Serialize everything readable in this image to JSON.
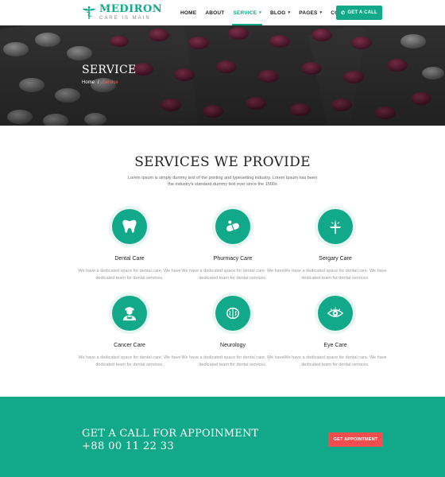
{
  "brand": {
    "name": "MEDIRON",
    "tagline": "CARE IS MAIN",
    "color": "#11a98a"
  },
  "nav": {
    "items": [
      {
        "label": "HOME",
        "dropdown": false,
        "active": false
      },
      {
        "label": "ABOUT",
        "dropdown": false,
        "active": false
      },
      {
        "label": "SERVICE",
        "dropdown": true,
        "active": true
      },
      {
        "label": "BLOG",
        "dropdown": true,
        "active": false
      },
      {
        "label": "PAGES",
        "dropdown": true,
        "active": false
      },
      {
        "label": "CONTACT",
        "dropdown": false,
        "active": false
      }
    ],
    "call_button": "GET A CALL"
  },
  "hero": {
    "title": "SERVICE",
    "breadcrumb": {
      "home": "Home",
      "separator": "/",
      "current": "Service"
    }
  },
  "services": {
    "title": "SERVICES WE PROVIDE",
    "description": "Lorem Ipsum is simply dummy text of the printing and typesetting industry. Lorem Ipsum has been the industry's standard dummy text ever since the 1500s",
    "items": [
      {
        "title": "Dental Care",
        "icon": "tooth-icon",
        "text": "We have a dedicated space for dental care. We have dedicated team for dental services."
      },
      {
        "title": "Phurmacy Care",
        "icon": "pills-icon",
        "text": "We have a dedicated space for dental care. We have dedicated team for dental services."
      },
      {
        "title": "Sergary Care",
        "icon": "scalpel-icon",
        "text": "We have a dedicated space for dental care. We have dedicated team for dental services."
      },
      {
        "title": "Cancer Care",
        "icon": "doctor-icon",
        "text": "We have a dedicated space for dental care. We have dedicated team for dental services."
      },
      {
        "title": "Neurology",
        "icon": "brain-icon",
        "text": "We have a dedicated space for dental care. We have dedicated team for dental services."
      },
      {
        "title": "Eye Care",
        "icon": "eye-icon",
        "text": "We have a dedicated space for dental care. We have dedicated team for dental services."
      }
    ]
  },
  "cta": {
    "title": "GET A CALL FOR APPOINMENT",
    "phone": "+88 00 11 22 33",
    "button": "GET APPOINTMENT",
    "button_color": "#f04e4e"
  }
}
